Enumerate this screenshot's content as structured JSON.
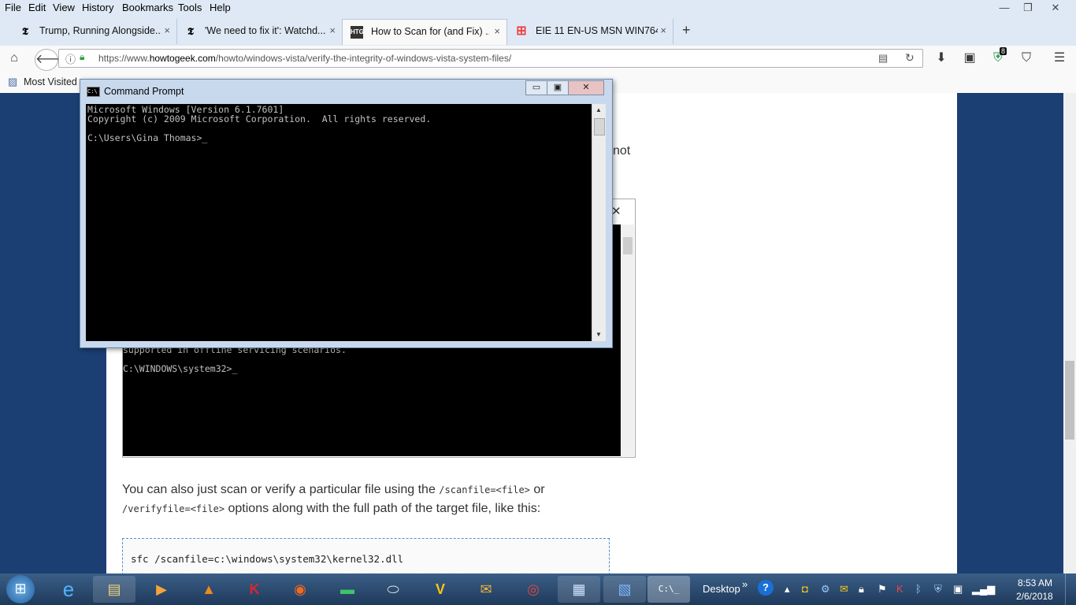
{
  "menu": {
    "items": [
      "File",
      "Edit",
      "View",
      "History",
      "Bookmarks",
      "Tools",
      "Help"
    ]
  },
  "window_controls": {
    "minimize": "—",
    "maximize": "❐",
    "close": "✕"
  },
  "tabs": [
    {
      "label": "Trump, Running Alongside...",
      "icon": "nyt-icon",
      "icon_char": "𝕿",
      "close": "×",
      "active": false
    },
    {
      "label": "'We need to fix it': Watchd...",
      "icon": "nyt-icon",
      "icon_char": "𝕿",
      "close": "×",
      "active": false
    },
    {
      "label": "How to Scan for (and Fix) ...",
      "icon": "htg-icon",
      "icon_char": "HTG",
      "close": "×",
      "active": true
    },
    {
      "label": "EIE 11 EN-US MSN WIN764....",
      "icon": "windows-logo-icon",
      "icon_char": "⊞",
      "close": "×",
      "active": false
    }
  ],
  "new_tab": "+",
  "nav": {
    "url_prefix": "https://www.",
    "url_domain": "howtogeek.com",
    "url_path": "/howto/windows-vista/verify-the-integrity-of-windows-vista-system-files/",
    "badge": "8"
  },
  "bookmarks": {
    "most_visited": "Most Visited"
  },
  "cmd": {
    "title": "Command Prompt",
    "lines": [
      "Microsoft Windows [Version 6.1.7601]",
      "Copyright (c) 2009 Microsoft Corporation.  All rights reserved.",
      "",
      "C:\\Users\\Gina Thomas>_"
    ],
    "min": "▭",
    "max": "▣",
    "close": "✕"
  },
  "article": {
    "fragment_text": "not",
    "embedded_lines": [
      "supported in offline servicing scenarios.",
      "",
      "C:\\WINDOWS\\system32>_"
    ],
    "para_start": "You can also just scan or verify a particular file using the ",
    "code1": "/scanfile=<file>",
    "para_or": " or",
    "code2": "/verifyfile=<file>",
    "para_end": " options along with the full path of the target file, like this:",
    "codeblock": "sfc /scanfile=c:\\windows\\system32\\kernel32.dll",
    "embedded_close": "✕"
  },
  "taskbar": {
    "desktop_label": "Desktop",
    "chevron": "»",
    "time": "8:53 AM",
    "date": "2/6/2018",
    "apps": [
      "start-orb",
      "internet-explorer",
      "file-explorer",
      "media-player",
      "vlc",
      "kaspersky",
      "firefox",
      "network-tool",
      "scanner",
      "norton",
      "outlook",
      "chrome",
      "remote-desktop",
      "paint",
      "command-prompt"
    ]
  }
}
